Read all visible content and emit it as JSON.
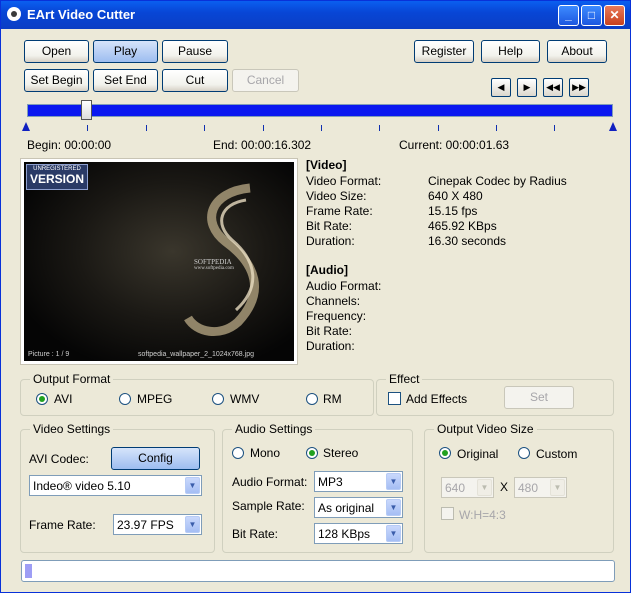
{
  "window": {
    "title": "EArt Video Cutter",
    "controls": {
      "minimize": "_",
      "maximize": "□",
      "close": "✕"
    }
  },
  "toolbar": {
    "open": "Open",
    "play": "Play",
    "pause": "Pause",
    "set_begin": "Set Begin",
    "set_end": "Set End",
    "cut": "Cut",
    "cancel": "Cancel",
    "register": "Register",
    "help": "Help",
    "about": "About"
  },
  "nav_icons": [
    "prev-frame-icon",
    "next-frame-icon",
    "rewind-icon",
    "fast-forward-icon"
  ],
  "timeline": {
    "begin": "Begin: 00:00:00",
    "end": "End: 00:00:16.302",
    "current": "Current: 00:00:01.63",
    "position_fraction": 0.1
  },
  "preview": {
    "badge_top": "UNREGISTERED",
    "badge_main": "VERSION",
    "watermark": "SOFTPEDIA",
    "watermark_sub": "www.softpedia.com",
    "caption_left": "Picture : 1 / 9",
    "caption_right": "softpedia_wallpaper_2_1024x768.jpg"
  },
  "video_info": {
    "header": "[Video]",
    "rows": [
      {
        "label": "Video Format:",
        "value": "Cinepak Codec by Radius"
      },
      {
        "label": "Video Size:",
        "value": "640 X 480"
      },
      {
        "label": "Frame Rate:",
        "value": "15.15 fps"
      },
      {
        "label": "Bit Rate:",
        "value": "465.92 KBps"
      },
      {
        "label": "Duration:",
        "value": "16.30 seconds"
      }
    ]
  },
  "audio_info": {
    "header": "[Audio]",
    "rows": [
      {
        "label": "Audio Format:",
        "value": ""
      },
      {
        "label": "Channels:",
        "value": ""
      },
      {
        "label": "Frequency:",
        "value": ""
      },
      {
        "label": "Bit Rate:",
        "value": ""
      },
      {
        "label": "Duration:",
        "value": ""
      }
    ]
  },
  "output_format": {
    "title": "Output Format",
    "options": [
      "AVI",
      "MPEG",
      "WMV",
      "RM"
    ],
    "selected": "AVI"
  },
  "effect": {
    "title": "Effect",
    "add_effects": "Add Effects",
    "set": "Set",
    "checked": false
  },
  "video_settings": {
    "title": "Video Settings",
    "codec_label": "AVI Codec:",
    "config": "Config",
    "codec": "Indeo® video 5.10",
    "frame_rate_label": "Frame Rate:",
    "frame_rate": "23.97 FPS"
  },
  "audio_settings": {
    "title": "Audio Settings",
    "mono": "Mono",
    "stereo": "Stereo",
    "selected": "Stereo",
    "audio_format_label": "Audio Format:",
    "audio_format": "MP3",
    "sample_rate_label": "Sample Rate:",
    "sample_rate": "As original",
    "bit_rate_label": "Bit Rate:",
    "bit_rate": "128 KBps"
  },
  "output_size": {
    "title": "Output Video Size",
    "original": "Original",
    "custom": "Custom",
    "selected": "Original",
    "width": "640",
    "x": "X",
    "height": "480",
    "ratio": "W:H=4:3"
  },
  "progress": {
    "fraction": 0.012
  },
  "colors": {
    "title_bar": "#0A5FF0",
    "track": "#0A18F0",
    "face": "#ECE9D8",
    "radio_dot": "#21A121"
  }
}
